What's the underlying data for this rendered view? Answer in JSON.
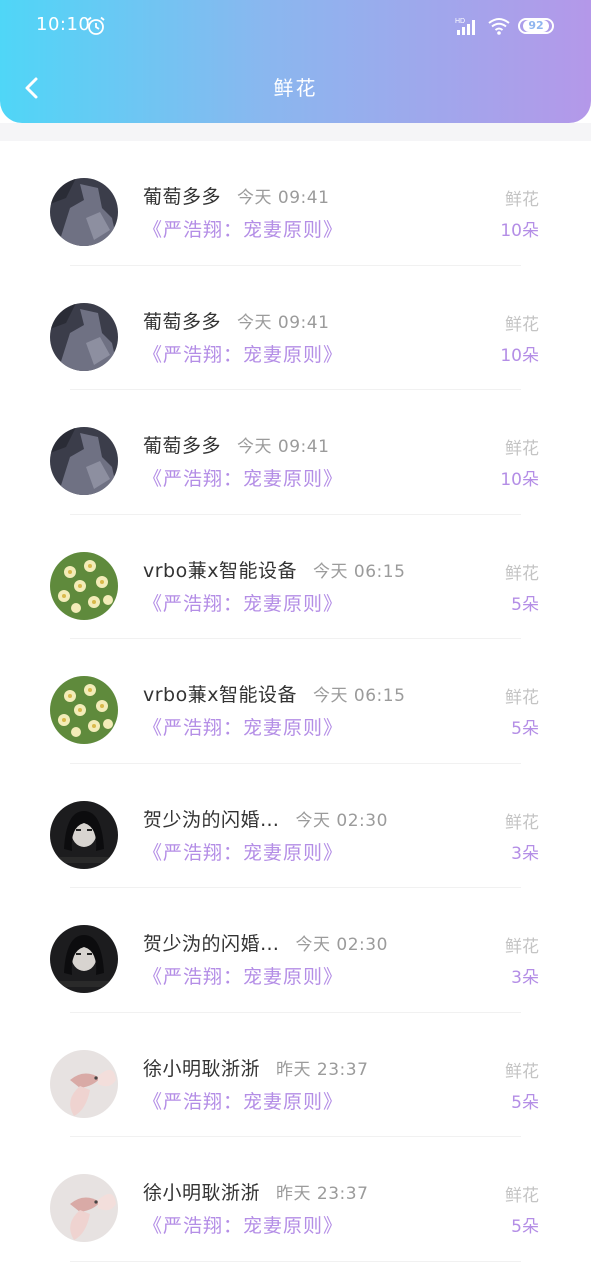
{
  "status_bar": {
    "time": "10:10",
    "battery": "92",
    "network_badge": "HD"
  },
  "header": {
    "title": "鲜花",
    "gradient_colors": [
      "#4fd6f7",
      "#b498e9"
    ]
  },
  "records": [
    {
      "name": "葡萄多多",
      "time": "今天  09:41",
      "book": "《严浩翔：宠妻原则》",
      "gift": "鲜花",
      "count": "10朵",
      "avatar": "dark-abstract"
    },
    {
      "name": "葡萄多多",
      "time": "今天  09:41",
      "book": "《严浩翔：宠妻原则》",
      "gift": "鲜花",
      "count": "10朵",
      "avatar": "dark-abstract"
    },
    {
      "name": "葡萄多多",
      "time": "今天  09:41",
      "book": "《严浩翔：宠妻原则》",
      "gift": "鲜花",
      "count": "10朵",
      "avatar": "dark-abstract"
    },
    {
      "name": "vrbo蒹x智能设备",
      "time": "今天  06:15",
      "book": "《严浩翔：宠妻原则》",
      "gift": "鲜花",
      "count": "5朵",
      "avatar": "yellow-flowers"
    },
    {
      "name": "vrbo蒹x智能设备",
      "time": "今天  06:15",
      "book": "《严浩翔：宠妻原则》",
      "gift": "鲜花",
      "count": "5朵",
      "avatar": "yellow-flowers"
    },
    {
      "name": "贺少沩的闪婚…",
      "time": "今天  02:30",
      "book": "《严浩翔：宠妻原则》",
      "gift": "鲜花",
      "count": "3朵",
      "avatar": "dark-portrait"
    },
    {
      "name": "贺少沩的闪婚…",
      "time": "今天  02:30",
      "book": "《严浩翔：宠妻原则》",
      "gift": "鲜花",
      "count": "3朵",
      "avatar": "dark-portrait"
    },
    {
      "name": "徐小明耿浙浙",
      "time": "昨天  23:37",
      "book": "《严浩翔：宠妻原则》",
      "gift": "鲜花",
      "count": "5朵",
      "avatar": "pink-fish"
    },
    {
      "name": "徐小明耿浙浙",
      "time": "昨天  23:37",
      "book": "《严浩翔：宠妻原则》",
      "gift": "鲜花",
      "count": "5朵",
      "avatar": "pink-fish"
    }
  ]
}
